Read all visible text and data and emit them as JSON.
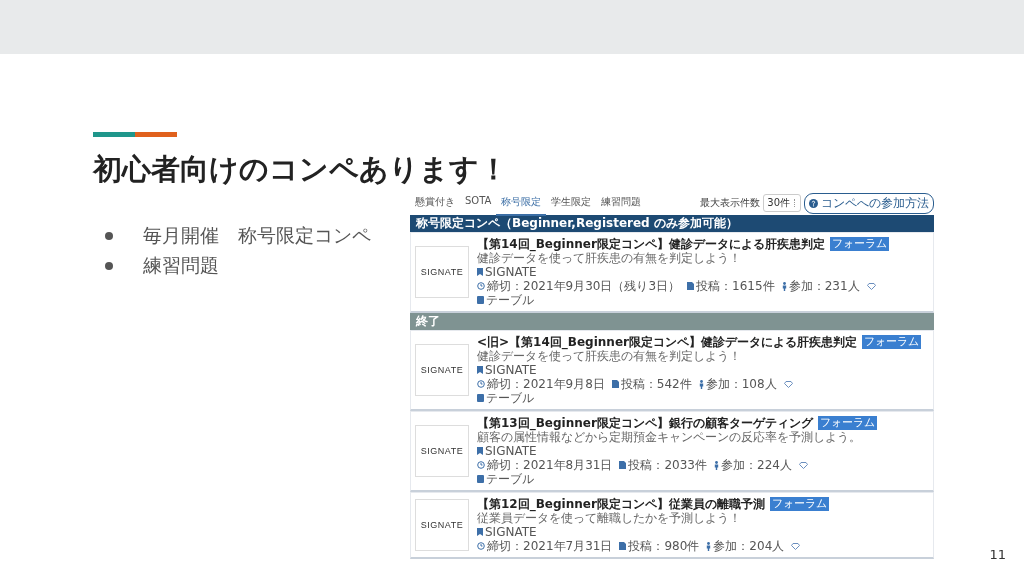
{
  "slide": {
    "title": "初心者向けのコンペあります！",
    "bullets": [
      "毎月開催　称号限定コンペ",
      "練習問題"
    ],
    "page_number": "11"
  },
  "site": {
    "tabs": [
      {
        "label": "懸賞付き",
        "selected": false
      },
      {
        "label": "SOTA",
        "selected": false
      },
      {
        "label": "称号限定",
        "selected": true
      },
      {
        "label": "学生限定",
        "selected": false
      },
      {
        "label": "練習問題",
        "selected": false
      }
    ],
    "per_page_label": "最大表示件数",
    "per_page": "30件",
    "help_button": "コンペへの参加方法",
    "sections": [
      {
        "kind": "open",
        "header": "称号限定コンペ（Beginner,Registered のみ参加可能）",
        "rows": [
          {
            "logo": "SIGNATE",
            "title": "【第14回_Beginner限定コンペ】健診データによる肝疾患判定",
            "tag": "フォーラム",
            "description": "健診データを使って肝疾患の有無を判定しよう！",
            "organizer": "SIGNATE",
            "deadline": "締切：2021年9月30日（残り3日）",
            "posts": "投稿：1615件",
            "participants": "参加：231人",
            "category": "テーブル"
          }
        ]
      },
      {
        "kind": "ended",
        "header": "終了",
        "rows": [
          {
            "logo": "SIGNATE",
            "title": "<旧>【第14回_Beginner限定コンペ】健診データによる肝疾患判定",
            "tag": "フォーラム",
            "description": "健診データを使って肝疾患の有無を判定しよう！",
            "organizer": "SIGNATE",
            "deadline": "締切：2021年9月8日",
            "posts": "投稿：542件",
            "participants": "参加：108人",
            "category": "テーブル"
          },
          {
            "logo": "SIGNATE",
            "title": "【第13回_Beginner限定コンペ】銀行の顧客ターゲティング",
            "tag": "フォーラム",
            "description": "顧客の属性情報などから定期預金キャンペーンの反応率を予測しよう。",
            "organizer": "SIGNATE",
            "deadline": "締切：2021年8月31日",
            "posts": "投稿：2033件",
            "participants": "参加：224人",
            "category": "テーブル"
          },
          {
            "logo": "SIGNATE",
            "title": "【第12回_Beginner限定コンペ】従業員の離職予測",
            "tag": "フォーラム",
            "description": "従業員データを使って離職したかを予測しよう！",
            "organizer": "SIGNATE",
            "deadline": "締切：2021年7月31日",
            "posts": "投稿：980件",
            "participants": "参加：204人"
          }
        ]
      }
    ]
  }
}
